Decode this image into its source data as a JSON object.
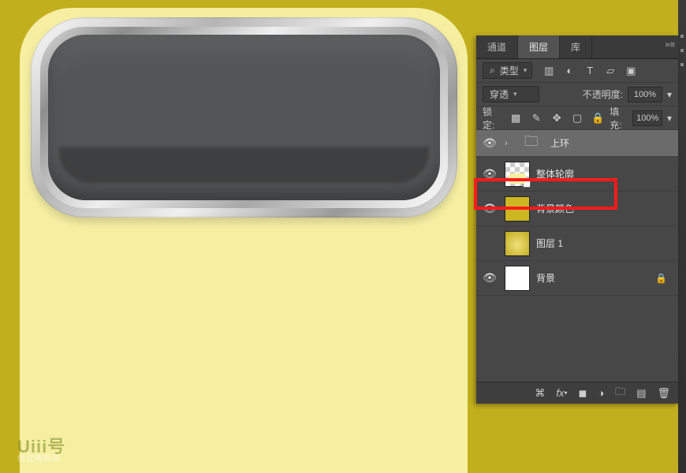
{
  "watermark": {
    "title": "Uiii号",
    "subtitle": "优优教程网"
  },
  "tabs": {
    "channels": "通道",
    "layers": "图层",
    "library": "库"
  },
  "filter": {
    "search_prefix": "⌕",
    "type_label": "类型",
    "icons": [
      "image-icon",
      "adjust-icon",
      "text-icon",
      "shape-icon",
      "smart-icon"
    ]
  },
  "blend": {
    "mode": "穿透",
    "opacity_label": "不透明度:",
    "opacity_value": "100%"
  },
  "lock": {
    "label": "锁定:",
    "fill_label": "填充:",
    "fill_value": "100%"
  },
  "layers": [
    {
      "id": "group-top",
      "kind": "group",
      "name": "上环",
      "visible": true,
      "selected": true
    },
    {
      "id": "outline",
      "kind": "smart",
      "name": "整体轮廓",
      "visible": true
    },
    {
      "id": "bg-color",
      "kind": "solid",
      "name": "背景颜色",
      "visible": true
    },
    {
      "id": "layer-1",
      "kind": "grad",
      "name": "图层 1",
      "visible": false
    },
    {
      "id": "background",
      "kind": "white",
      "name": "背景",
      "visible": true,
      "locked": true
    }
  ],
  "footer_icons": [
    "link-icon",
    "fx-icon",
    "mask-icon",
    "adjustment-icon",
    "group-icon",
    "new-layer-icon",
    "trash-icon"
  ]
}
